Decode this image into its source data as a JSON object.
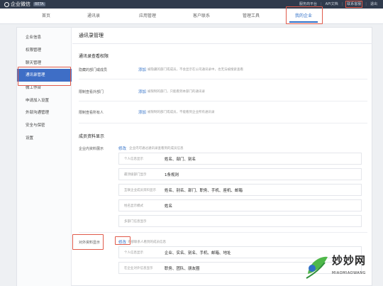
{
  "app": {
    "name": "企业微信",
    "tag": "BETA"
  },
  "toplinks": [
    "服务商平台",
    "API文档",
    "联系客服",
    "退出"
  ],
  "nav": [
    "首页",
    "通讯录",
    "应用管理",
    "客户联系",
    "管理工具",
    "我的企业"
  ],
  "sidebar": [
    "企业信息",
    "权限管理",
    "聊天管理",
    "通讯录管理",
    "微工作台",
    "申请加入设置",
    "外部沟通管理",
    "安全与保密",
    "设置"
  ],
  "page_title": "通讯录管理",
  "section1": {
    "title": "通讯录查看权限",
    "rows": [
      {
        "label": "隐藏的部门或成员",
        "link": "添加",
        "desc": "被隐藏的部门或成员，不会显示在公司通讯录中，也无法被搜索查看"
      },
      {
        "label": "限制查看外部门",
        "link": "添加",
        "desc": "被限制的部门，只能看到本部门的通讯录"
      },
      {
        "label": "限制查看所有人",
        "link": "添加",
        "desc": "被限制的部门或成员，不能看到企业所有通讯录"
      }
    ]
  },
  "section2": {
    "title": "成员资料显示",
    "row_label": "企业内资料展示",
    "link": "修改",
    "desc": "企业内可通过通讯录查看到的成员信息",
    "fields": [
      {
        "label": "个人信息显示",
        "value": "姓名、部门、别名"
      },
      {
        "label": "最顶级部门显示",
        "value": "1条规则"
      },
      {
        "label": "互联企业成员资料显示",
        "value": "姓名、别名、部门、职务、手机、座机、邮箱"
      },
      {
        "label": "姓名显示模式",
        "value": "姓名"
      },
      {
        "label": "多部门信息显示",
        "value": ""
      }
    ]
  },
  "section3": {
    "row_label": "对外资料显示",
    "link": "修改",
    "desc": "外部联系人看到的成员信息",
    "fields": [
      {
        "label": "个人信息显示",
        "value": "企业、实名、别名、手机、邮箱、地址"
      },
      {
        "label": "在企业对外信息显示",
        "value": "职务、团队、朋友圈"
      }
    ]
  },
  "watermark": {
    "text": "妙妙网",
    "sub": "MIAOMIAOWANG"
  },
  "colors": {
    "accent": "#2f6fc7",
    "highlight": "#e05a4a",
    "sidebar_active": "#3e6ec6"
  }
}
